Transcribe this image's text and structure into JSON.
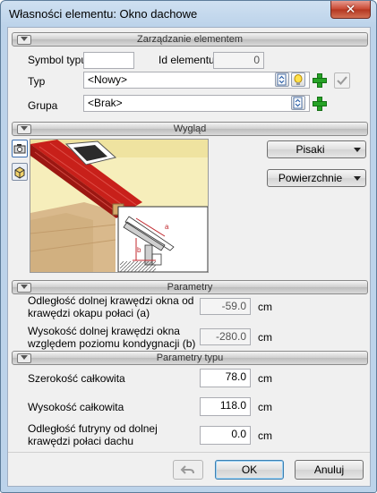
{
  "window": {
    "title": "Własności elementu: Okno dachowe",
    "close_glyph": "✕"
  },
  "sections": {
    "management": "Zarządzanie elementem",
    "appearance": "Wygląd",
    "parameters": "Parametry",
    "type_parameters": "Parametry typu"
  },
  "management": {
    "symbol_label": "Symbol typu",
    "symbol_value": "",
    "id_label": "Id elementu",
    "id_value": "0",
    "type_label": "Typ",
    "type_value": "<Nowy>",
    "group_label": "Grupa",
    "group_value": "<Brak>"
  },
  "appearance": {
    "pens_label": "Pisaki",
    "surfaces_label": "Powierzchnie",
    "diagram_label_a": "a",
    "diagram_label_b": "b"
  },
  "parameters": {
    "distance_label": "Odległość dolnej krawędzi okna od krawędzi okapu połaci (a)",
    "distance_value": "-59.0",
    "distance_unit": "cm",
    "height_label": "Wysokość dolnej krawędzi okna względem poziomu kondygnacji (b)",
    "height_value": "-280.0",
    "height_unit": "cm"
  },
  "type_parameters": {
    "width_label": "Szerokość całkowita",
    "width_value": "78.0",
    "width_unit": "cm",
    "total_height_label": "Wysokość całkowita",
    "total_height_value": "118.0",
    "total_height_unit": "cm",
    "frame_label": "Odległość futryny od dolnej krawędzi połaci dachu",
    "frame_value": "0.0",
    "frame_unit": "cm"
  },
  "footer": {
    "ok_label": "OK",
    "cancel_label": "Anuluj"
  },
  "colors": {
    "plus_green": "#26a326",
    "roof_red": "#c8201a",
    "bg_yellow": "#f5ecb0"
  }
}
